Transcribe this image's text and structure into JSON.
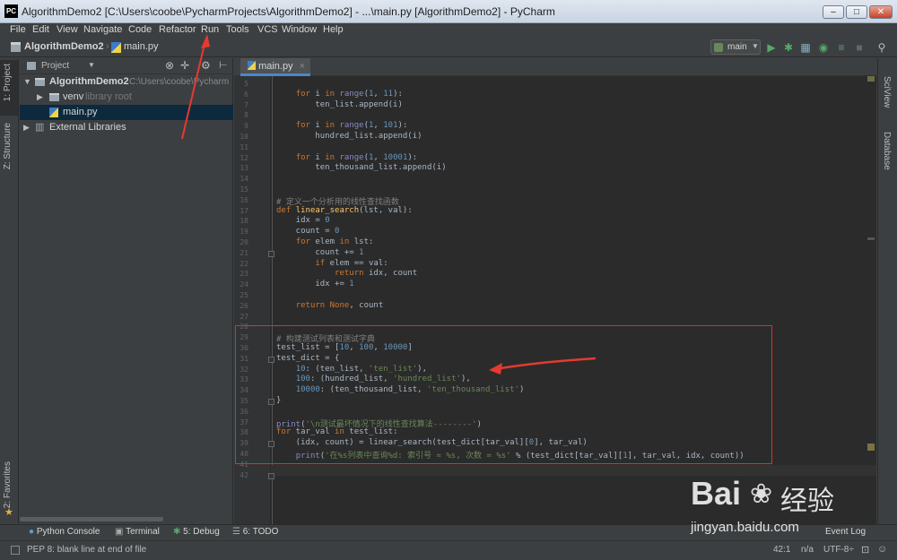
{
  "window": {
    "title": "AlgorithmDemo2 [C:\\Users\\coobe\\PycharmProjects\\AlgorithmDemo2] - ...\\main.py [AlgorithmDemo2] - PyCharm",
    "app_icon_text": "PC"
  },
  "menu": [
    "File",
    "Edit",
    "View",
    "Navigate",
    "Code",
    "Refactor",
    "Run",
    "Tools",
    "VCS",
    "Window",
    "Help"
  ],
  "breadcrumb": {
    "project": "AlgorithmDemo2",
    "file": "main.py"
  },
  "run_config": "main",
  "side_tabs": {
    "project": "1: Project",
    "structure": "Z: Structure",
    "favorites": "2: Favorites",
    "sciview": "SciView",
    "database": "Database"
  },
  "project_panel": {
    "title": "Project",
    "rows": [
      {
        "name": "AlgorithmDemo2",
        "suffix": "C:\\Users\\coobe\\Pycharm"
      },
      {
        "name": "venv",
        "suffix": "library root"
      },
      {
        "name": "main.py",
        "suffix": ""
      },
      {
        "name": "External Libraries",
        "suffix": ""
      }
    ]
  },
  "editor": {
    "tab": "main.py",
    "lines": [
      {
        "n": "5",
        "code": ""
      },
      {
        "n": "6",
        "code": "    for i in range(1, 11):"
      },
      {
        "n": "7",
        "code": "        ten_list.append(i)"
      },
      {
        "n": "8",
        "code": ""
      },
      {
        "n": "9",
        "code": "    for i in range(1, 101):"
      },
      {
        "n": "10",
        "code": "        hundred_list.append(i)"
      },
      {
        "n": "11",
        "code": ""
      },
      {
        "n": "12",
        "code": "    for i in range(1, 10001):"
      },
      {
        "n": "13",
        "code": "        ten_thousand_list.append(i)"
      },
      {
        "n": "14",
        "code": ""
      },
      {
        "n": "15",
        "code": ""
      },
      {
        "n": "16",
        "code": "# 定义一个分析用的线性查找函数"
      },
      {
        "n": "17",
        "code": "def linear_search(lst, val):"
      },
      {
        "n": "18",
        "code": "    idx = 0"
      },
      {
        "n": "19",
        "code": "    count = 0"
      },
      {
        "n": "20",
        "code": "    for elem in lst:"
      },
      {
        "n": "21",
        "code": "        count += 1"
      },
      {
        "n": "22",
        "code": "        if elem == val:"
      },
      {
        "n": "23",
        "code": "            return idx, count"
      },
      {
        "n": "24",
        "code": "        idx += 1"
      },
      {
        "n": "25",
        "code": ""
      },
      {
        "n": "26",
        "code": "    return None, count"
      },
      {
        "n": "27",
        "code": ""
      },
      {
        "n": "28",
        "code": ""
      },
      {
        "n": "29",
        "code": "# 构建测试列表和测试字典"
      },
      {
        "n": "30",
        "code": "test_list = [10, 100, 10000]"
      },
      {
        "n": "31",
        "code": "test_dict = {"
      },
      {
        "n": "32",
        "code": "    10: (ten_list, 'ten_list'),"
      },
      {
        "n": "33",
        "code": "    100: (hundred_list, 'hundred_list'),"
      },
      {
        "n": "34",
        "code": "    10000: (ten_thousand_list, 'ten_thousand_list')"
      },
      {
        "n": "35",
        "code": "}"
      },
      {
        "n": "36",
        "code": ""
      },
      {
        "n": "37",
        "code": "print('\\n测试最坏情况下的线性查找算法--------')"
      },
      {
        "n": "38",
        "code": "for tar_val in test_list:"
      },
      {
        "n": "39",
        "code": "    (idx, count) = linear_search(test_dict[tar_val][0], tar_val)"
      },
      {
        "n": "40",
        "code": "    print('在%s列表中查询%d: 索引号 = %s, 次数 = %s' % (test_dict[tar_val][1], tar_val, idx, count))"
      },
      {
        "n": "41",
        "code": ""
      },
      {
        "n": "42",
        "code": ""
      }
    ]
  },
  "bottom_tabs": {
    "python_console": "Python Console",
    "terminal": "Terminal",
    "debug": "5: Debug",
    "todo": "6: TODO",
    "event_log": "Event Log"
  },
  "status": {
    "message": "PEP 8: blank line at end of file",
    "position": "42:1",
    "na": "n/a",
    "encoding": "UTF-8÷"
  },
  "watermark": {
    "brand": "Bai",
    "brand2": "经验",
    "url": "jingyan.baidu.com"
  },
  "colors": {
    "accent": "#4a88c7",
    "annotation": "#d9322e",
    "keyword": "#cc7832",
    "string": "#6a8759",
    "number": "#6897bb"
  }
}
